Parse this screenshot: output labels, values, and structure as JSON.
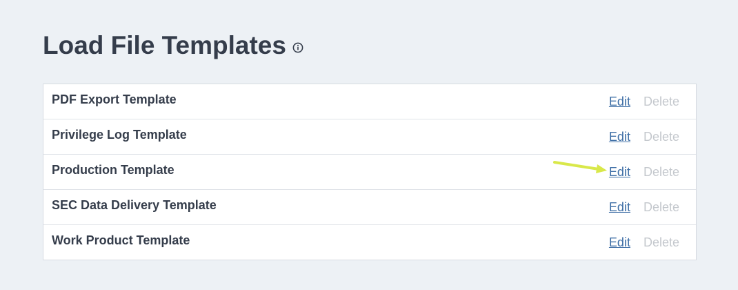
{
  "page": {
    "title": "Load File Templates"
  },
  "icons": {
    "info": "info-circle-icon"
  },
  "templates": [
    {
      "name": "PDF Export Template",
      "edit_label": "Edit",
      "delete_label": "Delete"
    },
    {
      "name": "Privilege Log Template",
      "edit_label": "Edit",
      "delete_label": "Delete"
    },
    {
      "name": "Production Template",
      "edit_label": "Edit",
      "delete_label": "Delete"
    },
    {
      "name": "SEC Data Delivery Template",
      "edit_label": "Edit",
      "delete_label": "Delete"
    },
    {
      "name": "Work Product Template",
      "edit_label": "Edit",
      "delete_label": "Delete"
    }
  ],
  "colors": {
    "background": "#edf1f5",
    "title": "#353d4b",
    "edit_link": "#3f6fa6",
    "delete_disabled": "#c4c8cd",
    "annotation_arrow": "#d9e84a"
  }
}
